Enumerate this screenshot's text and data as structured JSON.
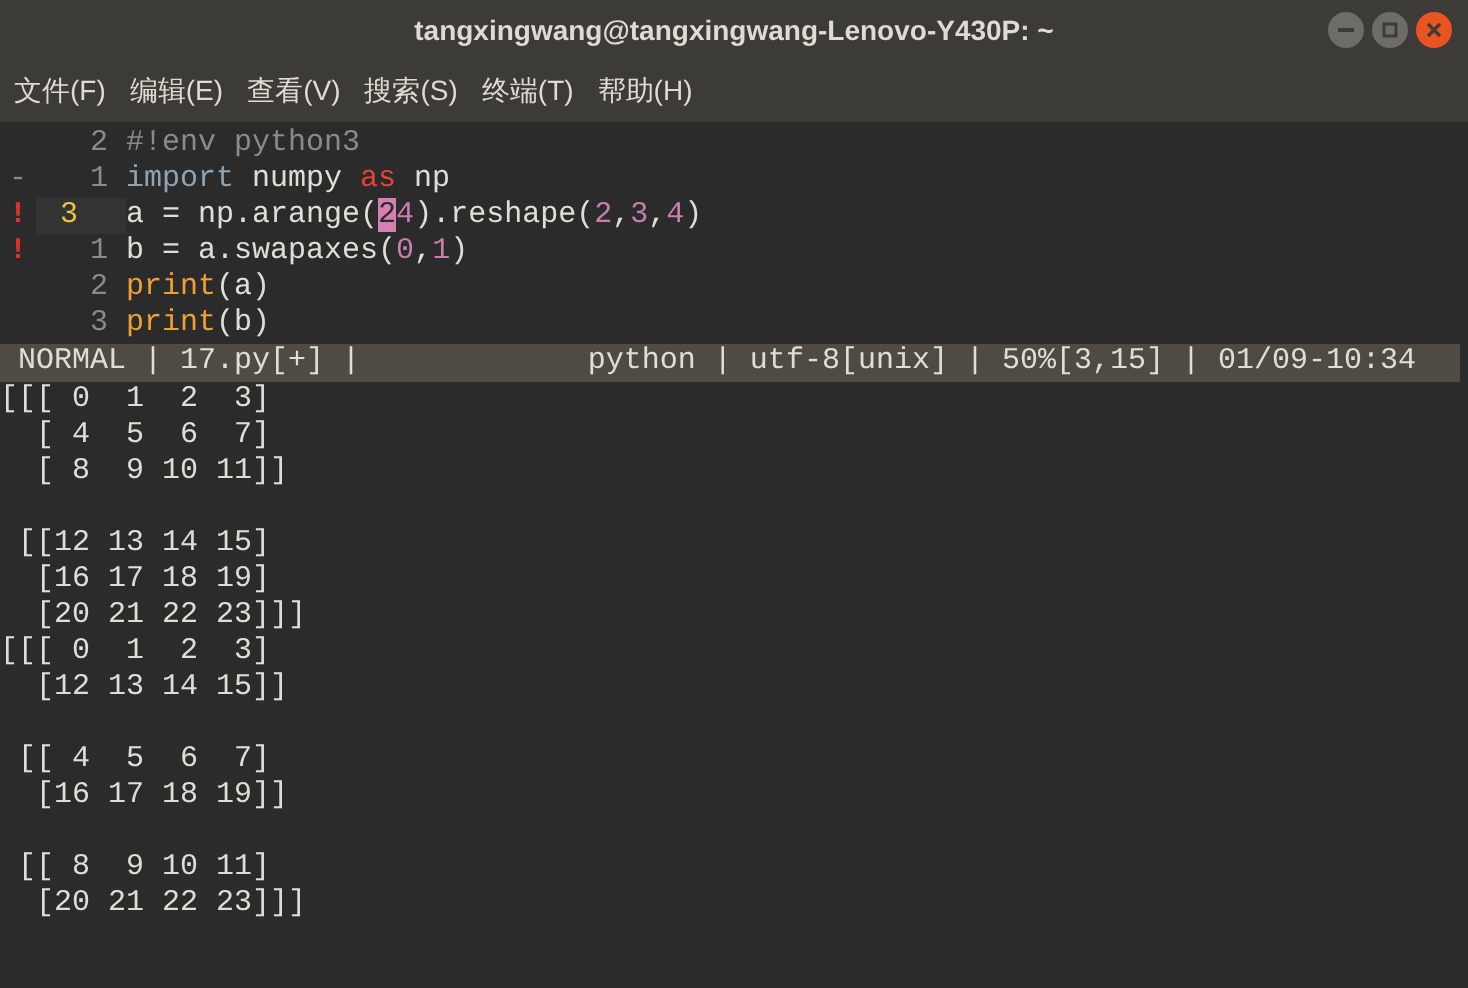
{
  "window": {
    "title": "tangxingwang@tangxingwang-Lenovo-Y430P: ~"
  },
  "menu": [
    "文件(F)",
    "编辑(E)",
    "查看(V)",
    "搜索(S)",
    "终端(T)",
    "帮助(H)"
  ],
  "editor": {
    "lines": [
      {
        "number": "2",
        "current": false,
        "tokens": [
          {
            "text": "#!env python3",
            "kind": "comment"
          }
        ]
      },
      {
        "sign": "-",
        "kind": "change",
        "number": "1",
        "current": false,
        "tokens": [
          {
            "text": "import",
            "kind": "keyword"
          },
          {
            "text": " numpy ",
            "kind": "plain"
          },
          {
            "text": "as",
            "kind": "operator"
          },
          {
            "text": " np",
            "kind": "plain"
          }
        ]
      },
      {
        "sign": "!",
        "kind": "error",
        "number": "3",
        "current": true,
        "tokens": [
          {
            "text": "a = np.arange(",
            "kind": "plain"
          },
          {
            "text": "2",
            "kind": "cursor"
          },
          {
            "text": "4",
            "kind": "number"
          },
          {
            "text": ").reshape(",
            "kind": "plain"
          },
          {
            "text": "2",
            "kind": "number"
          },
          {
            "text": ",",
            "kind": "plain"
          },
          {
            "text": "3",
            "kind": "number"
          },
          {
            "text": ",",
            "kind": "plain"
          },
          {
            "text": "4",
            "kind": "number"
          },
          {
            "text": ")",
            "kind": "plain"
          }
        ]
      },
      {
        "sign": "!",
        "kind": "error",
        "number": "1",
        "current": false,
        "tokens": [
          {
            "text": "b = a.swapaxes(",
            "kind": "plain"
          },
          {
            "text": "0",
            "kind": "number"
          },
          {
            "text": ",",
            "kind": "plain"
          },
          {
            "text": "1",
            "kind": "number"
          },
          {
            "text": ")",
            "kind": "plain"
          }
        ]
      },
      {
        "number": "2",
        "current": false,
        "tokens": [
          {
            "text": "print",
            "kind": "builtin"
          },
          {
            "text": "(a)",
            "kind": "plain"
          }
        ]
      },
      {
        "number": "3",
        "current": false,
        "tokens": [
          {
            "text": "print",
            "kind": "builtin"
          },
          {
            "text": "(b)",
            "kind": "plain"
          }
        ]
      }
    ]
  },
  "status_bar": {
    "left": "NORMAL | 17.py[+] |",
    "right": "python | utf-8[unix] | 50%[3,15] | 01/09-10:34"
  },
  "output": [
    [
      "[[[ 0  1  2  3]",
      "  [ 4  5  6  7]",
      "  [ 8  9 10 11]]"
    ],
    [
      " [[12 13 14 15]",
      "  [16 17 18 19]",
      "  [20 21 22 23]]]",
      "[[[ 0  1  2  3]",
      "  [12 13 14 15]]"
    ],
    [
      " [[ 4  5  6  7]",
      "  [16 17 18 19]]"
    ],
    [
      " [[ 8  9 10 11]",
      "  [20 21 22 23]]]"
    ]
  ]
}
